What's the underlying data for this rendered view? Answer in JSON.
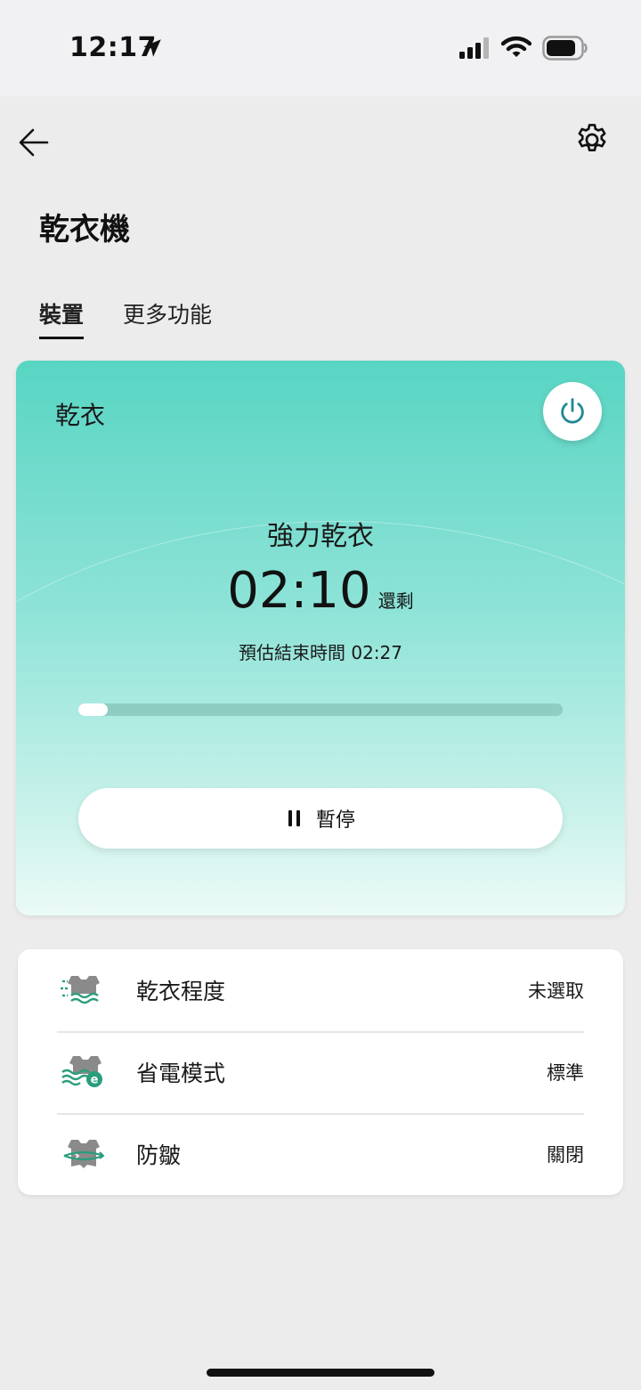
{
  "status_bar": {
    "time": "12:17",
    "icons": [
      "location-arrow-icon",
      "cellular-signal-icon",
      "wifi-icon",
      "battery-icon"
    ]
  },
  "header": {
    "title": "乾衣機",
    "icons": [
      "back-arrow-icon",
      "gear-icon"
    ]
  },
  "tabs": [
    {
      "label": "裝置",
      "active": true
    },
    {
      "label": "更多功能",
      "active": false
    }
  ],
  "status_card": {
    "label": "乾衣",
    "program": "強力乾衣",
    "time_remaining": "02:10",
    "remaining_label": "還剩",
    "end_time_label": "預估結束時間 02:27",
    "progress_fraction": 0.06,
    "pause_label": "暫停",
    "icons": [
      "power-icon",
      "pause-icon"
    ]
  },
  "settings": [
    {
      "label": "乾衣程度",
      "value": "未選取",
      "icon": "dryness-level-icon"
    },
    {
      "label": "省電模式",
      "value": "標準",
      "icon": "eco-mode-icon"
    },
    {
      "label": "防皺",
      "value": "關閉",
      "icon": "anti-wrinkle-icon"
    }
  ],
  "colors": {
    "accent": "#1f8a93",
    "icon_green": "#2a9d7c",
    "icon_gray": "#8a8a8a",
    "card_gradient_top": "#58d5c3",
    "card_gradient_bottom": "#ebfaf6"
  }
}
